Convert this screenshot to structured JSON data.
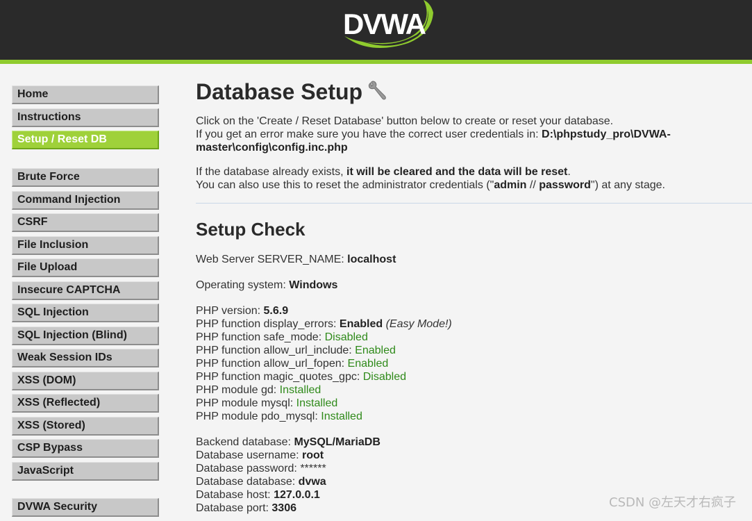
{
  "header": {
    "logo_text": "DVWA",
    "brand_color": "#8fcb2e",
    "background_color": "#2a2a2a"
  },
  "sidebar": {
    "group1": [
      {
        "label": "Home",
        "selected": false
      },
      {
        "label": "Instructions",
        "selected": false
      },
      {
        "label": "Setup / Reset DB",
        "selected": true
      }
    ],
    "group2": [
      {
        "label": "Brute Force"
      },
      {
        "label": "Command Injection"
      },
      {
        "label": "CSRF"
      },
      {
        "label": "File Inclusion"
      },
      {
        "label": "File Upload"
      },
      {
        "label": "Insecure CAPTCHA"
      },
      {
        "label": "SQL Injection"
      },
      {
        "label": "SQL Injection (Blind)"
      },
      {
        "label": "Weak Session IDs"
      },
      {
        "label": "XSS (DOM)"
      },
      {
        "label": "XSS (Reflected)"
      },
      {
        "label": "XSS (Stored)"
      },
      {
        "label": "CSP Bypass"
      },
      {
        "label": "JavaScript"
      }
    ],
    "group3": [
      {
        "label": "DVWA Security"
      }
    ]
  },
  "main": {
    "title": "Database Setup",
    "title_icon": "wrench-icon",
    "intro": {
      "line1": "Click on the 'Create / Reset Database' button below to create or reset your database.",
      "line2_prefix": "If you get an error make sure you have the correct user credentials in: ",
      "config_path_part1": "D:\\phpstudy_pro\\DVWA-",
      "config_path_part2": "master\\config\\config.inc.php",
      "line3_prefix": "If the database already exists, ",
      "line3_bold": "it will be cleared and the data will be reset",
      "line3_suffix": ".",
      "line4_prefix": "You can also use this to reset the administrator credentials (\"",
      "line4_user": "admin",
      "line4_sep": " // ",
      "line4_pass": "password",
      "line4_suffix": "\") at any stage."
    },
    "setup_check": {
      "title": "Setup Check",
      "server_name_label": "Web Server SERVER_NAME: ",
      "server_name_value": "localhost",
      "os_label": "Operating system: ",
      "os_value": "Windows",
      "php_version_label": "PHP version: ",
      "php_version_value": "5.6.9",
      "display_errors_label": "PHP function display_errors: ",
      "display_errors_value": "Enabled",
      "display_errors_note": " (Easy Mode!)",
      "safe_mode_label": "PHP function safe_mode: ",
      "safe_mode_value": "Disabled",
      "allow_url_include_label": "PHP function allow_url_include: ",
      "allow_url_include_value": "Enabled",
      "allow_url_fopen_label": "PHP function allow_url_fopen: ",
      "allow_url_fopen_value": "Enabled",
      "magic_quotes_label": "PHP function magic_quotes_gpc: ",
      "magic_quotes_value": "Disabled",
      "gd_label": "PHP module gd: ",
      "gd_value": "Installed",
      "mysql_label": "PHP module mysql: ",
      "mysql_value": "Installed",
      "pdo_mysql_label": "PHP module pdo_mysql: ",
      "pdo_mysql_value": "Installed",
      "backend_label": "Backend database: ",
      "backend_value": "MySQL/MariaDB",
      "db_user_label": "Database username: ",
      "db_user_value": "root",
      "db_pass_label": "Database password: ",
      "db_pass_value": "******",
      "db_name_label": "Database database: ",
      "db_name_value": "dvwa",
      "db_host_label": "Database host: ",
      "db_host_value": "127.0.0.1",
      "db_port_label": "Database port: ",
      "db_port_value": "3306",
      "status_ok_color": "#2f8a1a"
    }
  },
  "watermark": "CSDN @左天才右疯子"
}
